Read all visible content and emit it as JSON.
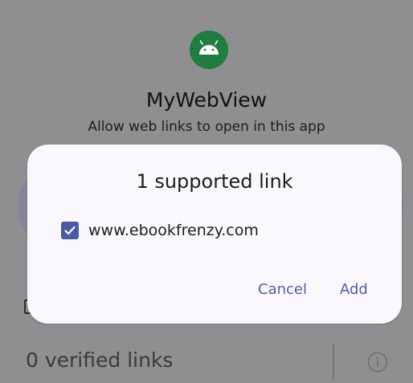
{
  "background": {
    "app_name": "MyWebView",
    "app_subtitle": "Allow web links to open in this app",
    "verified_links": "0 verified links",
    "app_icon": "android-icon",
    "info_icon": "info-icon"
  },
  "dialog": {
    "title": "1 supported link",
    "links": [
      {
        "url": "www.ebookfrenzy.com",
        "checked": true
      }
    ],
    "cancel_label": "Cancel",
    "add_label": "Add"
  },
  "colors": {
    "scrim": "#8f8f91",
    "dialog_bg": "#fbf8fd",
    "accent": "#4a5ba3",
    "button_text": "#4e5ea6",
    "app_icon_bg": "#1f7a3f"
  }
}
